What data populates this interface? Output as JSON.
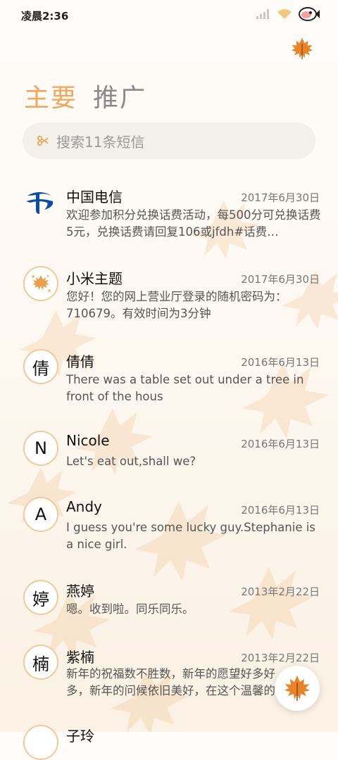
{
  "status": {
    "time": "凌晨2:36"
  },
  "tabs": {
    "primary": "主要",
    "promo": "推广"
  },
  "search": {
    "placeholder": "搜索11条短信"
  },
  "messages": [
    {
      "name": "中国电信",
      "date": "2017年6月30日",
      "snippet": "欢迎参加积分兑换话费活动，每500分可兑换话费5元，兑换话费请回复106或jfdh#话费…",
      "avatar": "",
      "avatar_icon": "china-telecom-logo"
    },
    {
      "name": "小米主题",
      "date": "2017年6月30日",
      "snippet": "您好！您的网上营业厅登录的随机密码为：710679。有效时间为3分钟",
      "avatar": "",
      "avatar_icon": "leaf-pattern-avatar"
    },
    {
      "name": "倩倩",
      "date": "2016年6月13日",
      "snippet": "There was a table set out under a tree in front of the hous",
      "avatar": "倩"
    },
    {
      "name": "Nicole",
      "date": "2016年6月13日",
      "snippet": "Let's eat out,shall we?",
      "avatar": "N"
    },
    {
      "name": "Andy",
      "date": "2016年6月13日",
      "snippet": "I guess you're some lucky guy.Stephanie is a nice girl.",
      "avatar": "A"
    },
    {
      "name": "燕婷",
      "date": "2013年2月22日",
      "snippet": "嗯。收到啦。同乐同乐。",
      "avatar": "婷"
    },
    {
      "name": "紫楠",
      "date": "2013年2月22日",
      "snippet": "新年的祝福数不胜数，新年的愿望好多好多，新年的问候依旧美好，在这个温馨的时",
      "avatar": "楠"
    },
    {
      "name": "子玲",
      "date": "",
      "snippet": "",
      "avatar": ""
    }
  ],
  "colors": {
    "accent": "#f1a85e",
    "avatar_border": "#f4c99a",
    "leaf": "#e8832a"
  },
  "icons": {
    "theme": "maple-leaf-icon",
    "fab": "maple-leaf-compose-icon",
    "search": "scissors-search-icon"
  }
}
